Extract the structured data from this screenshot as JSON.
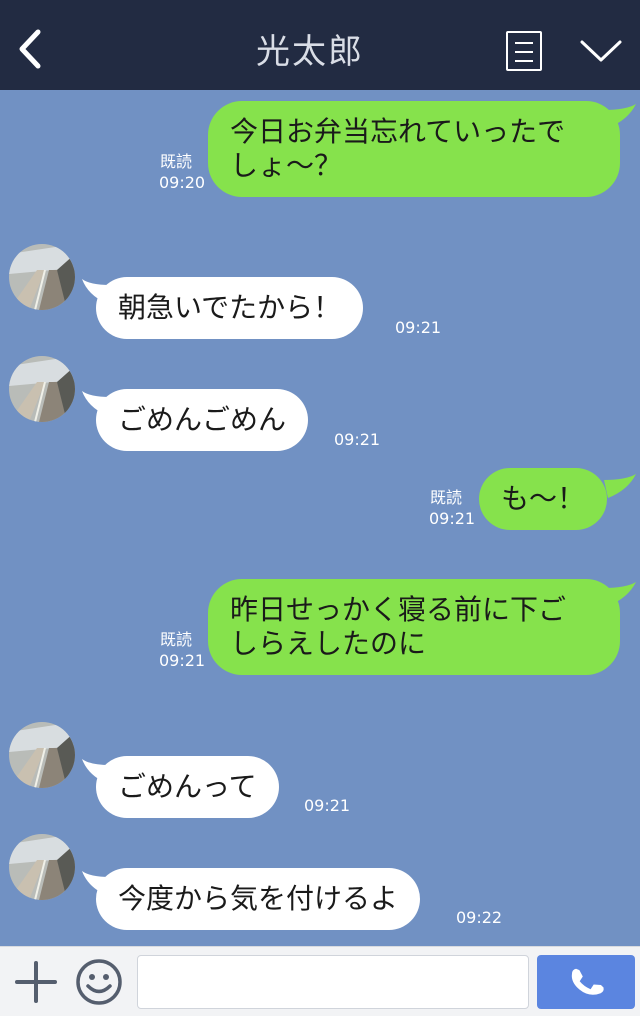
{
  "header": {
    "title": "光太郎",
    "back_icon": "chevron-left-icon",
    "menu_icon": "menu-icon",
    "collapse_icon": "chevron-down-icon"
  },
  "messages": [
    {
      "side": "sent",
      "text": "今日お弁当忘れていったで\nしょ〜？",
      "read": "既読",
      "time": "09:20"
    },
    {
      "side": "received",
      "text": "朝急いでたから！",
      "time": "09:21"
    },
    {
      "side": "received",
      "text": "ごめんごめん",
      "time": "09:21"
    },
    {
      "side": "sent",
      "text": "も〜！",
      "read": "既読",
      "time": "09:21"
    },
    {
      "side": "sent",
      "text": "昨日せっかく寝る前に下ご\nしらえしたのに",
      "read": "既読",
      "time": "09:21"
    },
    {
      "side": "received",
      "text": "ごめんって",
      "time": "09:21"
    },
    {
      "side": "received",
      "text": "今度から気を付けるよ",
      "time": "09:22"
    }
  ],
  "input_bar": {
    "plus_icon": "plus-icon",
    "emoji_icon": "smiley-icon",
    "message_value": "",
    "call_icon": "phone-icon"
  },
  "colors": {
    "header_bg": "#222b42",
    "chat_bg": "#7191c3",
    "sent_bubble": "#86e24c",
    "received_bubble": "#ffffff",
    "call_button": "#5b85e0"
  }
}
